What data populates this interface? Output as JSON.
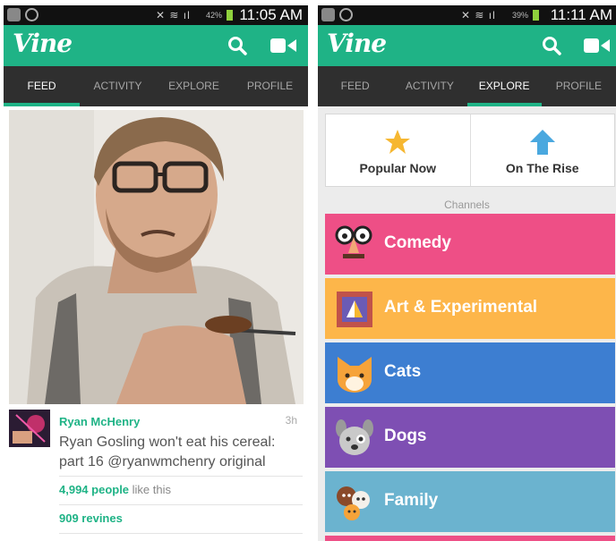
{
  "left": {
    "status": {
      "time": "11:05 AM",
      "battery": "42%"
    },
    "app_title": "Vine",
    "tabs": [
      {
        "label": "FEED",
        "active": true
      },
      {
        "label": "ACTIVITY",
        "active": false
      },
      {
        "label": "EXPLORE",
        "active": false
      },
      {
        "label": "PROFILE",
        "active": false
      }
    ],
    "post": {
      "author": "Ryan McHenry",
      "time": "3h",
      "caption": "Ryan Gosling won't eat his cereal: part 16 @ryanwmchenry original",
      "likes_count": "4,994 people",
      "likes_suffix": " like this",
      "revines": "909 revines"
    }
  },
  "right": {
    "status": {
      "time": "11:11 AM",
      "battery": "39%"
    },
    "app_title": "Vine",
    "tabs": [
      {
        "label": "FEED",
        "active": false
      },
      {
        "label": "ACTIVITY",
        "active": false
      },
      {
        "label": "EXPLORE",
        "active": true
      },
      {
        "label": "PROFILE",
        "active": false
      }
    ],
    "featured": [
      {
        "label": "Popular Now",
        "icon": "star-icon",
        "color": "#f6b731"
      },
      {
        "label": "On The Rise",
        "icon": "arrow-up-icon",
        "color": "#4aa8df"
      }
    ],
    "channels_label": "Channels",
    "channels": [
      {
        "label": "Comedy",
        "color": "#ee4f86",
        "icon": "comedy-glasses-icon"
      },
      {
        "label": "Art & Experimental",
        "color": "#fdb64a",
        "icon": "art-frame-icon"
      },
      {
        "label": "Cats",
        "color": "#3d7ed1",
        "icon": "cat-icon"
      },
      {
        "label": "Dogs",
        "color": "#7e4fb3",
        "icon": "dog-icon"
      },
      {
        "label": "Family",
        "color": "#6bb3cf",
        "icon": "family-icon"
      }
    ]
  },
  "colors": {
    "brand": "#1fb386",
    "tabbar": "#2f2f2f"
  }
}
